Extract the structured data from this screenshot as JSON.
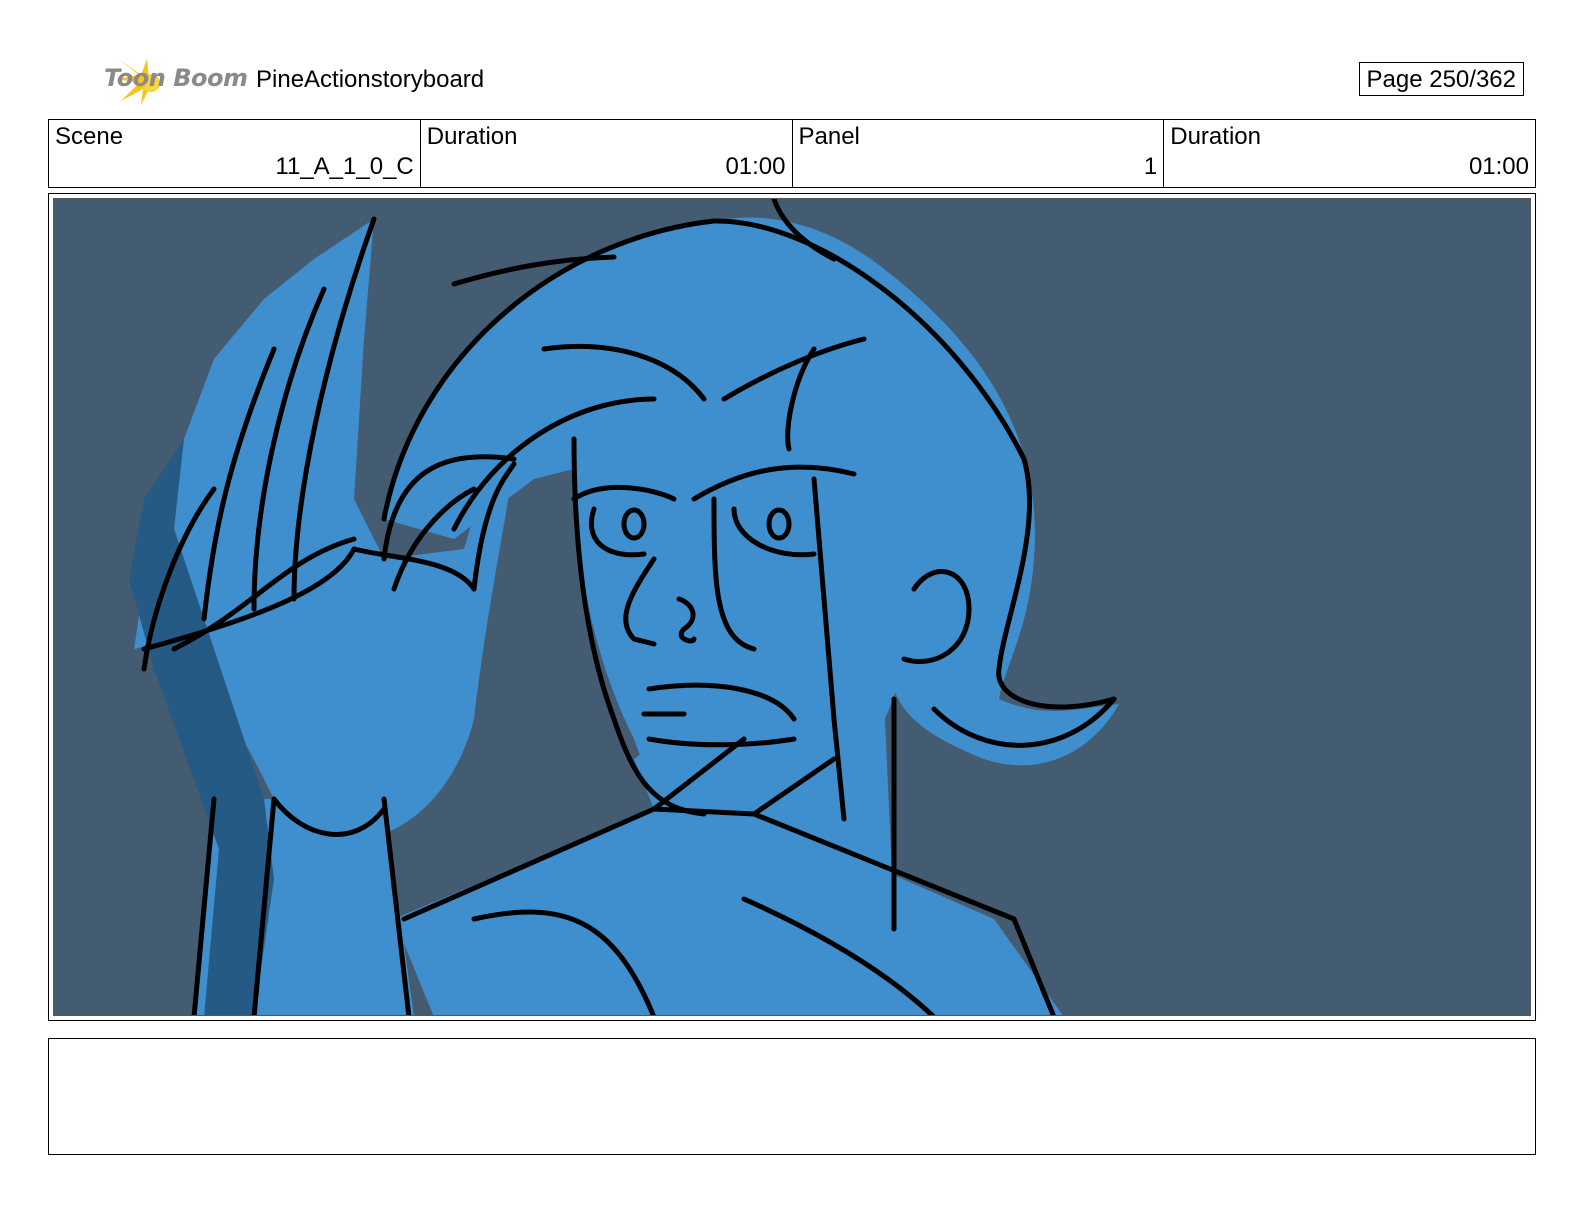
{
  "header": {
    "logo_text": "Toon Boom",
    "project_title": "PineActionstoryboard",
    "page_number": "Page 250/362"
  },
  "info": {
    "scene_label": "Scene",
    "scene_value": "11_A_1_0_C",
    "scene_duration_label": "Duration",
    "scene_duration_value": "01:00",
    "panel_label": "Panel",
    "panel_value": "1",
    "panel_duration_label": "Duration",
    "panel_duration_value": "01:00"
  },
  "panel": {
    "background_color": "#445c72",
    "figure_color": "#3f8fce",
    "shadow_color": "#255a85"
  },
  "notes": {
    "text": ""
  }
}
